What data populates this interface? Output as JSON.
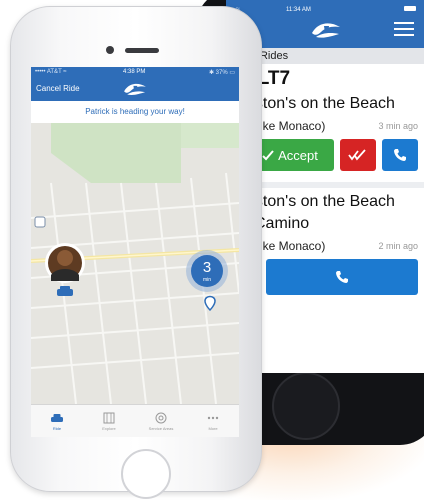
{
  "colors": {
    "brand_blue": "#2e6db8",
    "accept_green": "#3aa845",
    "decline_red": "#d62424",
    "call_blue": "#1c7ad0"
  },
  "back_phone": {
    "status_time": "11:34 AM",
    "section_header": "ading Rides",
    "ride1": {
      "code": "ALT7",
      "location": "oston's on the Beach",
      "rider": "(Mike Monaco)",
      "time_ago": "3 min ago",
      "accept_label": "Accept",
      "accept_icon": "check-icon",
      "decline_icon": "double-check-icon",
      "call_icon": "phone-icon"
    },
    "ride2": {
      "location_line1": "oston's on the Beach",
      "location_line2": "l Camino",
      "rider": "(Mike Monaco)",
      "time_ago": "2 min ago",
      "call_icon": "phone-icon"
    }
  },
  "front_phone": {
    "status": {
      "carrier": "••••• AT&T ≈",
      "time": "4:38 PM",
      "battery": "✱ 37% ▭"
    },
    "cancel_label": "Cancel Ride",
    "banner": "Patrick is heading your way!",
    "eta": {
      "value": "3",
      "unit": "min"
    },
    "tabs": [
      {
        "label": "Ride",
        "icon": "car-icon",
        "active": true
      },
      {
        "label": "Explore",
        "icon": "map-icon",
        "active": false
      },
      {
        "label": "Service Areas",
        "icon": "area-icon",
        "active": false
      },
      {
        "label": "More",
        "icon": "more-icon",
        "active": false
      }
    ]
  }
}
